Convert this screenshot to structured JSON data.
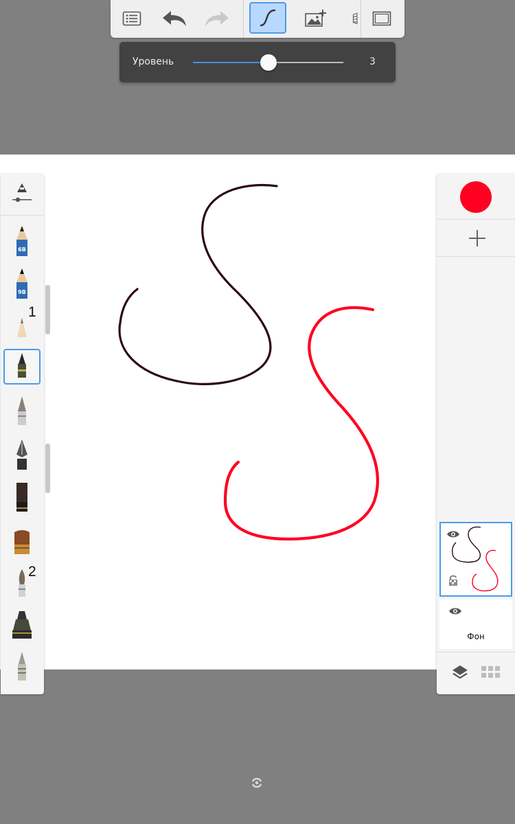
{
  "toolbar": {
    "items": [
      {
        "name": "menu",
        "icon": "list-icon"
      },
      {
        "name": "undo",
        "icon": "undo-arrow-icon"
      },
      {
        "name": "redo",
        "icon": "redo-arrow-icon",
        "disabled": true
      },
      {
        "name": "stroke",
        "icon": "stroke-curve-icon",
        "active": true
      },
      {
        "name": "add-image",
        "icon": "image-add-icon"
      },
      {
        "name": "perspective",
        "icon": "perspective-icon"
      },
      {
        "name": "fullscreen",
        "icon": "frame-icon"
      }
    ]
  },
  "level_slider": {
    "label": "Уровень",
    "value": "3",
    "position_fraction": 0.5,
    "accent_color": "#4a90e2"
  },
  "brush_palette": {
    "properties_icon": "brush-properties-icon",
    "selected_index": 3,
    "brushes": [
      {
        "name": "pencil-6b",
        "badge": "6B"
      },
      {
        "name": "pencil-9b",
        "badge": "9B"
      },
      {
        "name": "pencil-light",
        "number_label": "1"
      },
      {
        "name": "fineliner"
      },
      {
        "name": "airbrush-tip"
      },
      {
        "name": "fountain-pen"
      },
      {
        "name": "flat-brush"
      },
      {
        "name": "wide-brush"
      },
      {
        "name": "round-brush",
        "number_label": "2"
      },
      {
        "name": "marker"
      },
      {
        "name": "ballpoint"
      }
    ]
  },
  "layers_panel": {
    "current_color": "#ff0022",
    "add_label": "+",
    "layers": [
      {
        "name": "",
        "visible": true,
        "selected": true
      },
      {
        "name": "Фон",
        "visible": true,
        "selected": false
      }
    ],
    "footer_icons": [
      "layers-icon",
      "grid-icon"
    ]
  },
  "canvas": {
    "strokes": [
      {
        "color": "#2b0a10"
      },
      {
        "color": "#ff0022"
      }
    ]
  },
  "bottom": {
    "icon": "sync-icon"
  }
}
